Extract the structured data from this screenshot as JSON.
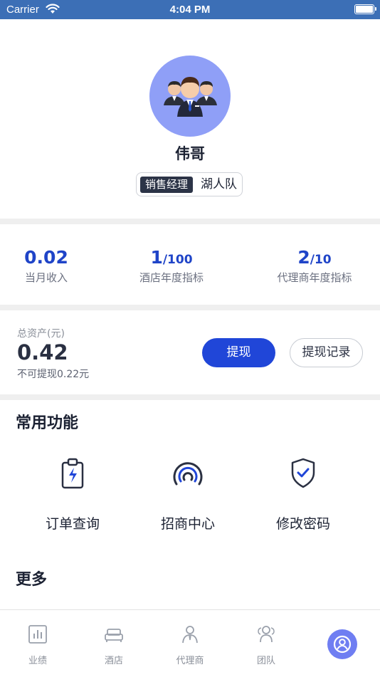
{
  "status_bar": {
    "carrier": "Carrier",
    "time": "4:04 PM"
  },
  "profile": {
    "name": "伟哥",
    "role": "销售经理",
    "team": "湖人队"
  },
  "stats": [
    {
      "value": "0.02",
      "total": "",
      "label": "当月收入"
    },
    {
      "value": "1",
      "total": "/100",
      "label": "酒店年度指标"
    },
    {
      "value": "2",
      "total": "/10",
      "label": "代理商年度指标"
    }
  ],
  "assets": {
    "title": "总资产(元)",
    "amount": "0.42",
    "note": "不可提现0.22元",
    "withdraw_label": "提现",
    "record_label": "提现记录"
  },
  "common": {
    "title": "常用功能",
    "items": [
      {
        "label": "订单查询",
        "icon": "order-clipboard-icon"
      },
      {
        "label": "招商中心",
        "icon": "signal-person-icon"
      },
      {
        "label": "修改密码",
        "icon": "shield-check-icon"
      }
    ]
  },
  "more": {
    "title": "更多"
  },
  "tabbar": {
    "items": [
      {
        "label": "业绩",
        "icon": "bar-chart-icon"
      },
      {
        "label": "酒店",
        "icon": "bed-icon"
      },
      {
        "label": "代理商",
        "icon": "agent-icon"
      },
      {
        "label": "团队",
        "icon": "team-icon"
      },
      {
        "label": "",
        "icon": "user-circle-icon",
        "active": true
      }
    ]
  },
  "colors": {
    "accent": "#2046d8",
    "status_bar": "#3c6fb6",
    "avatar_bg": "#8f9ff7",
    "tab_active": "#6f7ef2"
  }
}
